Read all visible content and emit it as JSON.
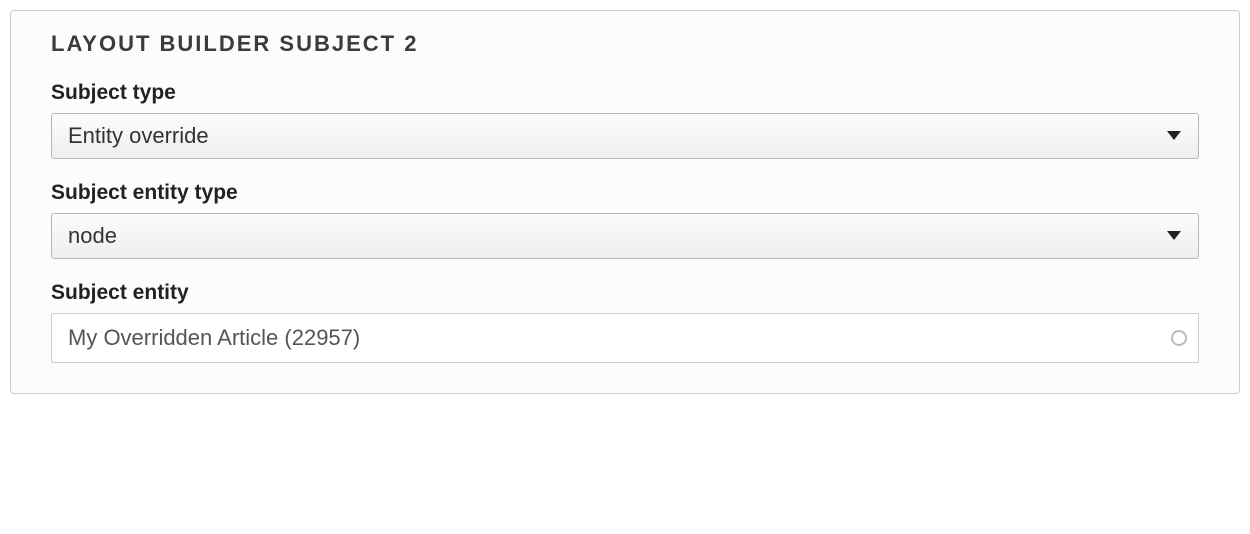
{
  "fieldset": {
    "title": "LAYOUT BUILDER SUBJECT 2",
    "subject_type": {
      "label": "Subject type",
      "value": "Entity override"
    },
    "subject_entity_type": {
      "label": "Subject entity type",
      "value": "node"
    },
    "subject_entity": {
      "label": "Subject entity",
      "value": "My Overridden Article (22957)"
    }
  }
}
